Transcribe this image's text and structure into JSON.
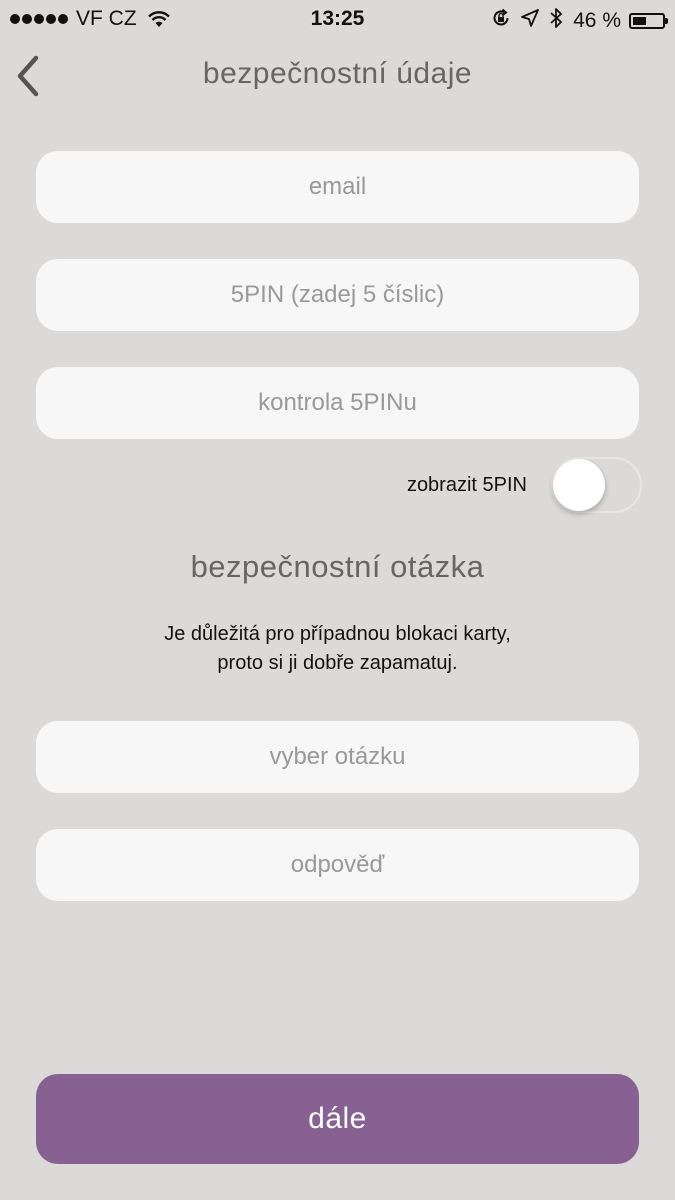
{
  "status_bar": {
    "carrier": "VF CZ",
    "time": "13:25",
    "battery": "46 %",
    "battery_level": 0.46,
    "icons": [
      "signal-dots",
      "wifi-icon",
      "rotation-lock-icon",
      "location-arrow-icon",
      "bluetooth-icon",
      "battery-icon"
    ]
  },
  "nav": {
    "back_icon": "chevron-left-icon",
    "title": "bezpečnostní údaje"
  },
  "form": {
    "email_placeholder": "email",
    "pin_placeholder": "5PIN (zadej 5 číslic)",
    "pin_check_placeholder": "kontrola 5PINu",
    "show_pin_label": "zobrazit 5PIN",
    "show_pin_on": false
  },
  "security_question": {
    "title": "bezpečnostní otázka",
    "note_line1": "Je důležitá pro případnou blokaci karty,",
    "note_line2": "proto si ji dobře zapamatuj.",
    "question_placeholder": "vyber otázku",
    "answer_placeholder": "odpověď"
  },
  "submit": {
    "label": "dále"
  },
  "colors": {
    "background": "#dcdad9",
    "field": "#f7f7f7",
    "accent": "#866192",
    "title_text": "#666666",
    "placeholder": "#999999"
  }
}
